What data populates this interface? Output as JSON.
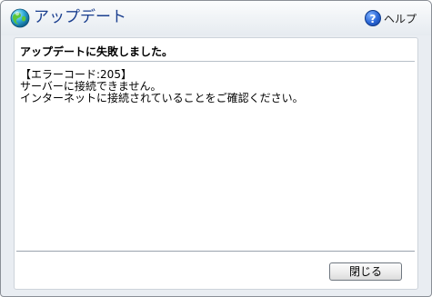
{
  "window": {
    "title": "アップデート",
    "help_label": "ヘルプ",
    "title_icon": "globe-icon",
    "help_icon": "help-icon"
  },
  "content": {
    "headline": "アップデートに失敗しました。",
    "messages": [
      "【エラーコード:205】",
      "サーバーに接続できません。",
      "インターネットに接続されていることをご確認ください。"
    ]
  },
  "buttons": {
    "close_label": "閉じる"
  },
  "colors": {
    "title_text": "#1b3f8f",
    "help_icon": "#2a66d6"
  }
}
